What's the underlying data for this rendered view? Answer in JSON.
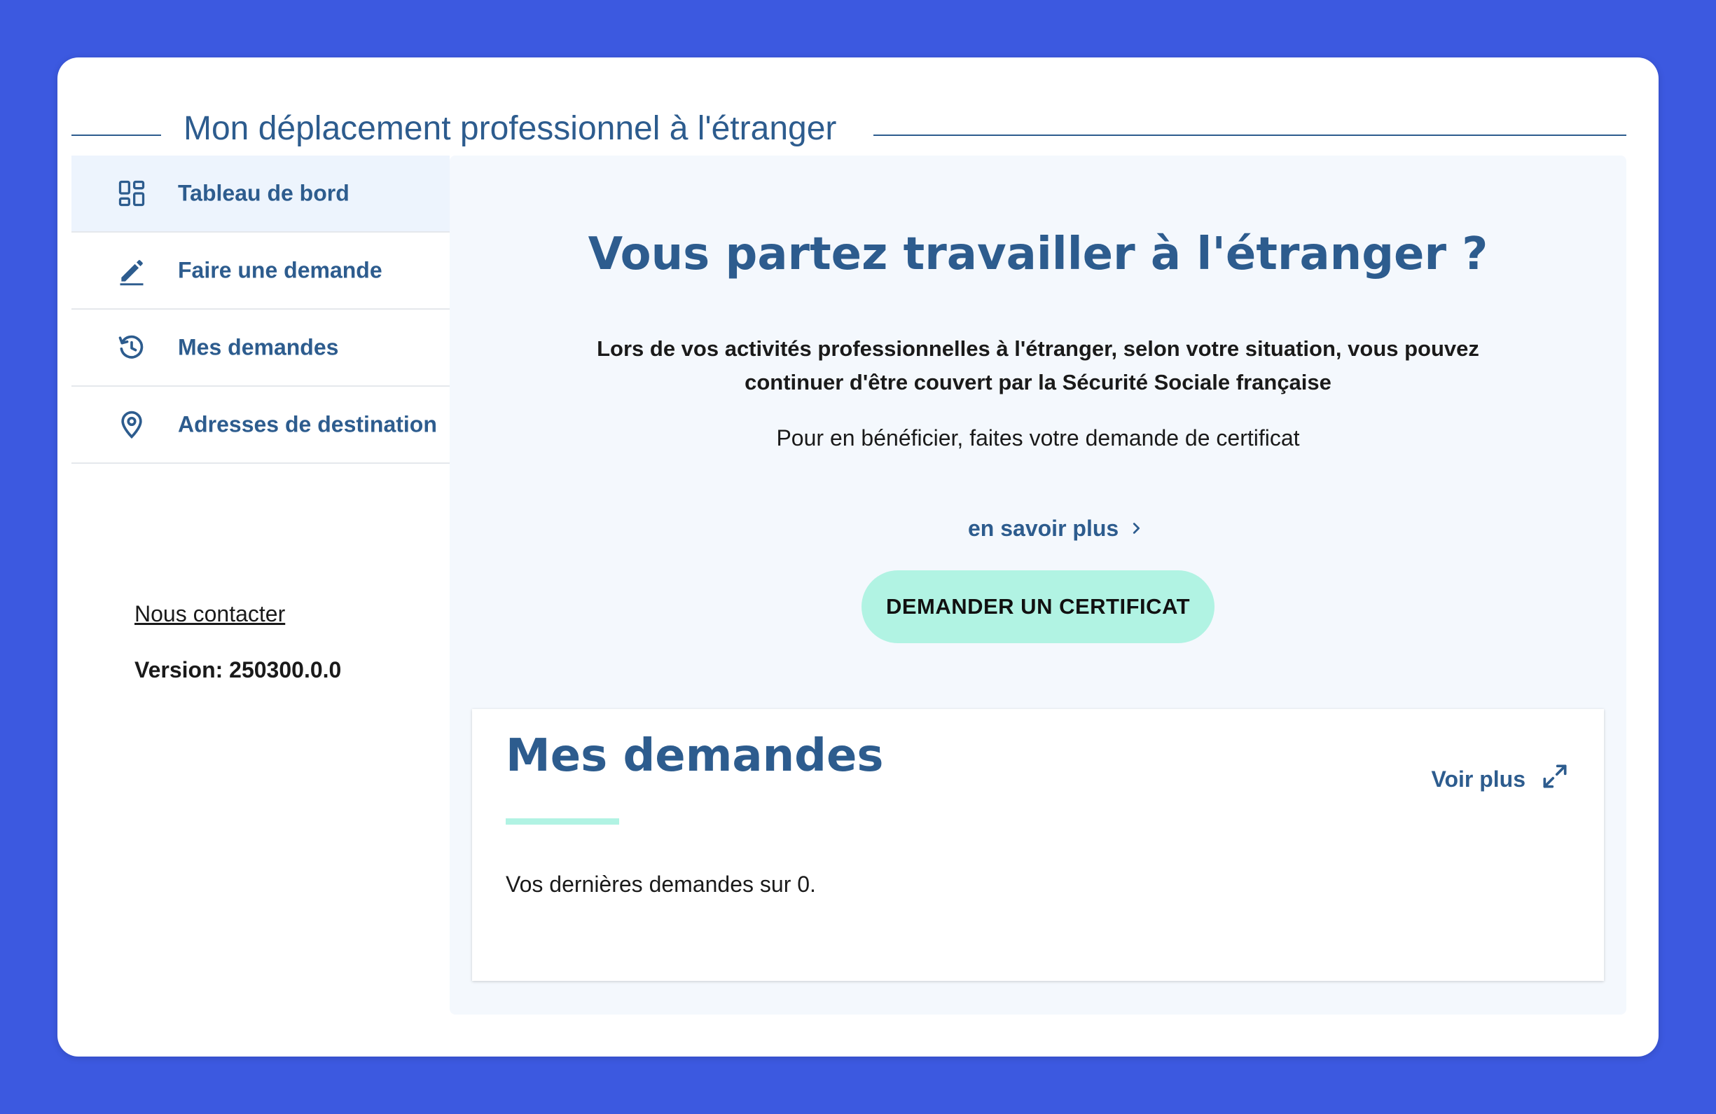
{
  "app": {
    "title": "Mon déplacement professionnel à l'étranger"
  },
  "sidebar": {
    "items": [
      {
        "label": "Tableau de bord",
        "icon": "dashboard-icon",
        "active": true
      },
      {
        "label": "Faire une demande",
        "icon": "pencil-icon",
        "active": false
      },
      {
        "label": "Mes demandes",
        "icon": "history-icon",
        "active": false
      },
      {
        "label": "Adresses de destination",
        "icon": "location-pin-icon",
        "active": false
      }
    ],
    "contact_label": "Nous contacter",
    "version_label": "Version: 250300.0.0"
  },
  "hero": {
    "title": "Vous partez travailler à l'étranger ?",
    "subtitle": "Lors de vos activités professionnelles à l'étranger, selon votre situation, vous pouvez continuer d'être couvert par la Sécurité Sociale française",
    "cta_text": "Pour en bénéficier, faites votre demande de certificat",
    "learn_more_label": "en savoir plus",
    "button_label": "DEMANDER UN CERTIFICAT"
  },
  "requests": {
    "title": "Mes demandes",
    "see_more_label": "Voir plus",
    "empty_text": "Vos dernières demandes sur 0."
  },
  "colors": {
    "background": "#3c59e0",
    "primary": "#2d5c8e",
    "accent": "#b1f3e3",
    "active_nav": "#edf4fd",
    "panel": "#f4f8fd"
  }
}
